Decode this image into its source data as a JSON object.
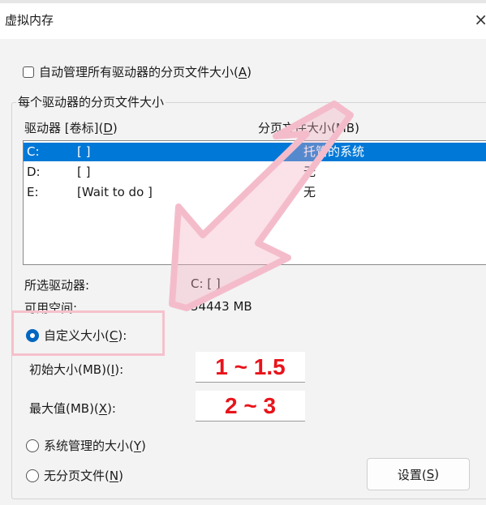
{
  "window": {
    "title": "虚拟内存",
    "close_glyph": "×"
  },
  "auto_manage": {
    "text": "自动管理所有驱动器的分页文件大小(",
    "key": "A",
    "suffix": ")",
    "checked": false
  },
  "group": {
    "label": "每个驱动器的分页文件大小"
  },
  "columns": {
    "drive": {
      "text": "驱动器 [卷标](",
      "key": "D",
      "suffix": ")"
    },
    "paging": "分页文件大小(MB)"
  },
  "drives": [
    {
      "letter": "C:",
      "label": "[ ]",
      "size": "托管的系统",
      "selected": true
    },
    {
      "letter": "D:",
      "label": "[ ]",
      "size": "无",
      "selected": false
    },
    {
      "letter": "E:",
      "label": "[Wait to do ]",
      "size": "无",
      "selected": false
    }
  ],
  "selected_drive": {
    "label": "所选驱动器:",
    "value": "C:  [ ]"
  },
  "available_space": {
    "label": "可用空间:",
    "value": "54443 MB"
  },
  "custom_size": {
    "text": "自定义大小(",
    "key": "C",
    "suffix": "):",
    "selected": true
  },
  "initial_size": {
    "label_text": "初始大小(MB)(",
    "key": "I",
    "suffix": "):",
    "value": "1 ~ 1.5"
  },
  "max_size": {
    "label_text": "最大值(MB)(",
    "key": "X",
    "suffix": "):",
    "value": "2 ~ 3"
  },
  "system_managed": {
    "text": "系统管理的大小(",
    "key": "Y",
    "suffix": ")",
    "selected": false
  },
  "no_paging": {
    "text": "无分页文件(",
    "key": "N",
    "suffix": ")",
    "selected": false
  },
  "set_button": {
    "text": "设置(",
    "key": "S",
    "suffix": ")"
  },
  "colors": {
    "accent": "#0067c0",
    "selection": "#0078d7",
    "annotation_red": "#e8141b",
    "annotation_pink": "#f6c1cc"
  }
}
